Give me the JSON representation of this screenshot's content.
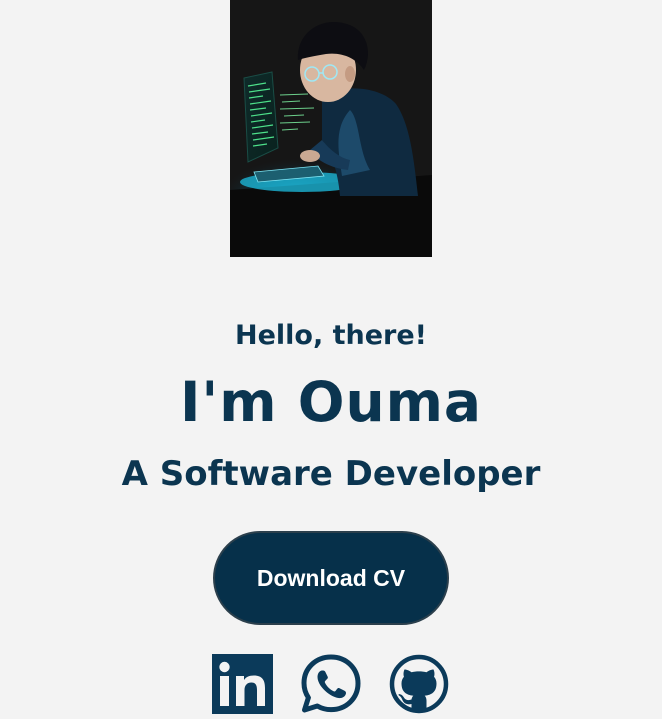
{
  "hero": {
    "image_icon": "coding-boy-illustration"
  },
  "intro": {
    "greeting": "Hello, there!",
    "name": "I'm Ouma",
    "role": "A Software Developer"
  },
  "cta": {
    "download_label": "Download CV"
  },
  "social": [
    {
      "icon": "linkedin-icon",
      "color": "#0b3a5a"
    },
    {
      "icon": "whatsapp-icon",
      "color": "#0b3a5a"
    },
    {
      "icon": "github-icon",
      "color": "#0b3a5a"
    }
  ],
  "colors": {
    "background": "#f3f3f3",
    "primary_text": "#0b3550",
    "button_bg": "#06304a",
    "button_text": "#ffffff"
  }
}
